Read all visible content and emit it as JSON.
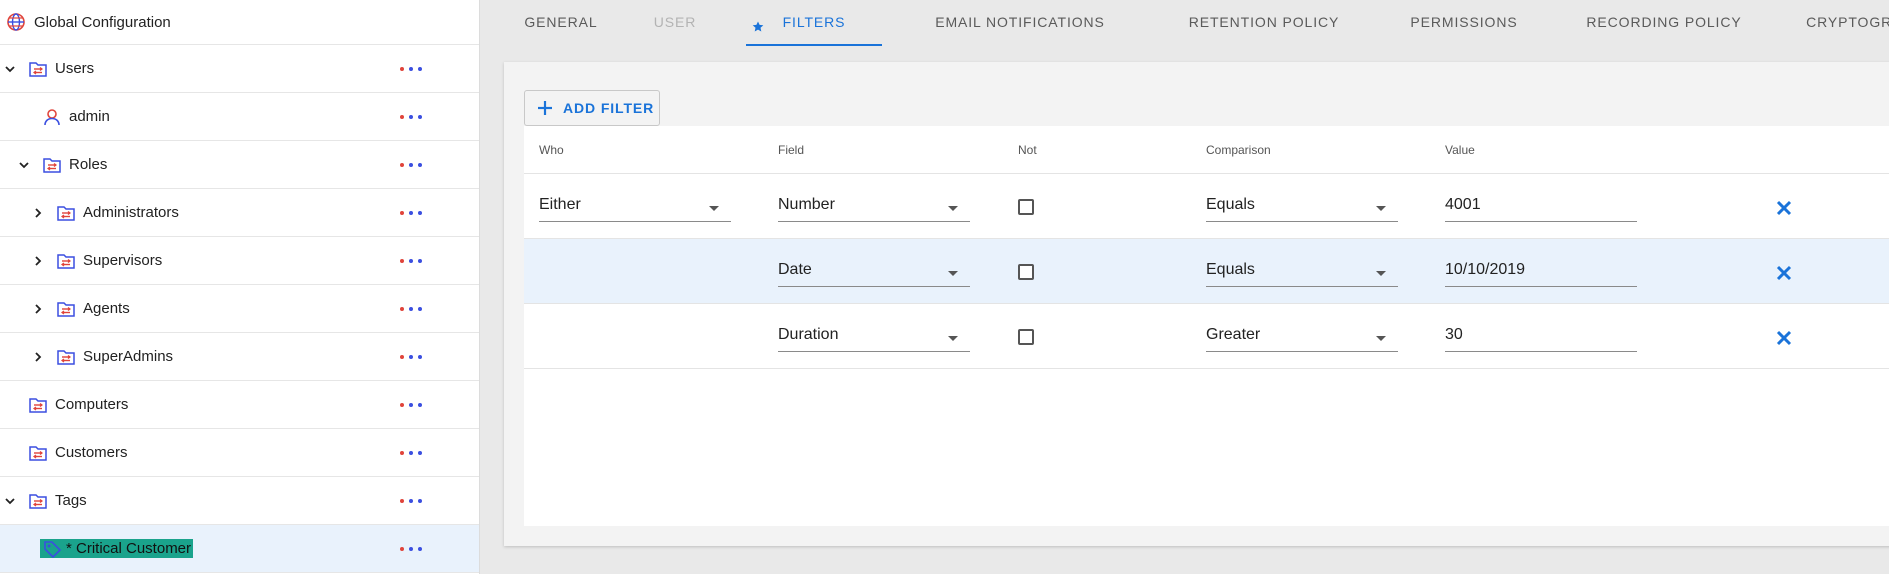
{
  "colors": {
    "accent": "#1a73d9",
    "folder_blue": "#3b4fe0",
    "folder_red": "#e0443b",
    "highlight": "#1aa38c"
  },
  "tree": {
    "root": {
      "label": "Global Configuration",
      "icon": "globe-icon"
    },
    "nodes": [
      {
        "label": "Users",
        "icon": "folder-icon",
        "chevron": "down",
        "level": 0
      },
      {
        "label": "admin",
        "icon": "user-icon",
        "chevron": "",
        "level": 1
      },
      {
        "label": "Roles",
        "icon": "folder-icon",
        "chevron": "down",
        "level": 1
      },
      {
        "label": "Administrators",
        "icon": "folder-icon",
        "chevron": "right",
        "level": 2
      },
      {
        "label": "Supervisors",
        "icon": "folder-icon",
        "chevron": "right",
        "level": 2
      },
      {
        "label": "Agents",
        "icon": "folder-icon",
        "chevron": "right",
        "level": 2
      },
      {
        "label": "SuperAdmins",
        "icon": "folder-icon",
        "chevron": "right",
        "level": 2
      },
      {
        "label": "Computers",
        "icon": "folder-icon",
        "chevron": "",
        "level": 0
      },
      {
        "label": "Customers",
        "icon": "folder-icon",
        "chevron": "",
        "level": 0
      },
      {
        "label": "Tags",
        "icon": "folder-icon",
        "chevron": "down",
        "level": 0
      },
      {
        "label": "* Critical Customer",
        "icon": "tag-icon",
        "chevron": "",
        "level": 1
      }
    ]
  },
  "tabs": [
    {
      "label": "GENERAL",
      "state": "normal"
    },
    {
      "label": "USER",
      "state": "disabled"
    },
    {
      "label": "FILTERS",
      "state": "active"
    },
    {
      "label": "EMAIL NOTIFICATIONS",
      "state": "normal"
    },
    {
      "label": "RETENTION POLICY",
      "state": "normal"
    },
    {
      "label": "PERMISSIONS",
      "state": "normal"
    },
    {
      "label": "RECORDING POLICY",
      "state": "normal"
    },
    {
      "label": "CRYPTOGRAPHY",
      "state": "normal"
    }
  ],
  "filters": {
    "add_label": "ADD FILTER",
    "columns": {
      "who": "Who",
      "field": "Field",
      "not": "Not",
      "comparison": "Comparison",
      "value": "Value"
    },
    "rows": [
      {
        "who": "Either",
        "field": "Number",
        "not": false,
        "comparison": "Equals",
        "value": "4001"
      },
      {
        "who": "",
        "field": "Date",
        "not": false,
        "comparison": "Equals",
        "value": "10/10/2019"
      },
      {
        "who": "",
        "field": "Duration",
        "not": false,
        "comparison": "Greater",
        "value": "30"
      }
    ]
  }
}
